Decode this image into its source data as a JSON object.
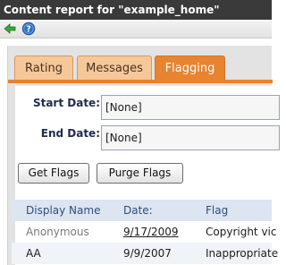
{
  "window": {
    "title": "Content report for \"example_home\""
  },
  "toolbar": {
    "back_icon": "green-back-arrow-icon",
    "help_icon": "help-icon"
  },
  "tabs": [
    {
      "label": "Rating",
      "selected": false
    },
    {
      "label": "Messages",
      "selected": false
    },
    {
      "label": "Flagging",
      "selected": true
    }
  ],
  "form": {
    "start_date_label": "Start Date:",
    "start_date_value": "[None]",
    "end_date_label": "End Date:",
    "end_date_value": "[None]"
  },
  "buttons": {
    "get_flags": "Get Flags",
    "purge_flags": "Purge Flags"
  },
  "table": {
    "columns": [
      "Display Name",
      "Date:",
      "Flag"
    ],
    "rows": [
      {
        "name": "Anonymous",
        "date": "9/17/2009",
        "flag": "Copyright vic"
      },
      {
        "name": "AA",
        "date": "9/9/2007",
        "flag": "Inappropriate"
      }
    ]
  },
  "colors": {
    "accent": "#e8832f",
    "tab_inactive": "#f6c799",
    "label_text": "#232c4a",
    "header_bg": "#dde5f1",
    "header_text": "#2e4d7d"
  }
}
